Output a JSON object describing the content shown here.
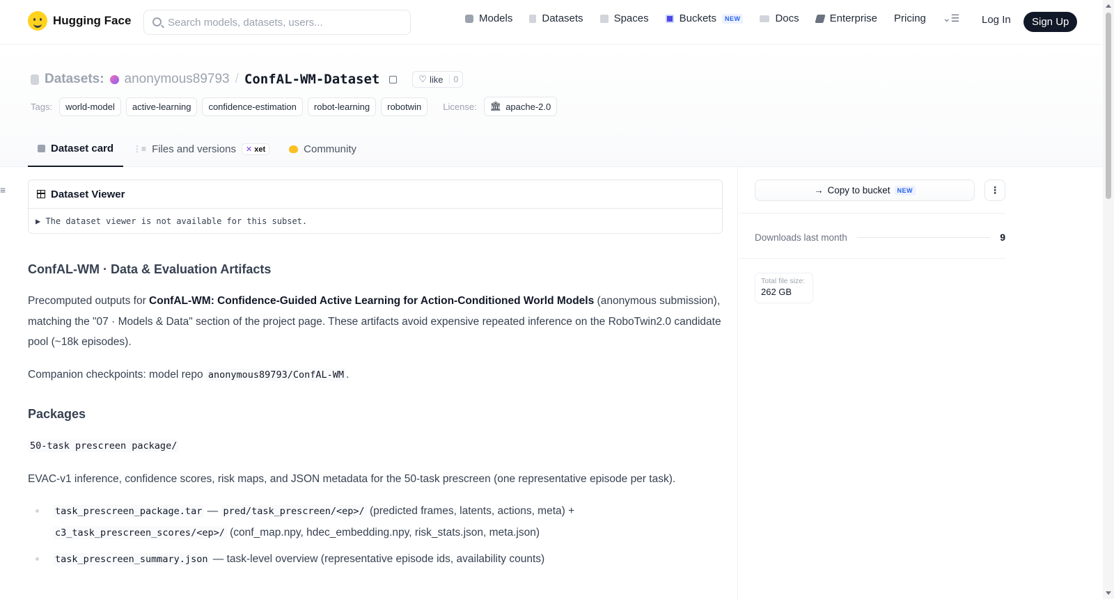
{
  "header": {
    "brand": "Hugging Face",
    "search_placeholder": "Search models, datasets, users...",
    "nav": [
      {
        "label": "Models",
        "icon": "model-cube-icon"
      },
      {
        "label": "Datasets",
        "icon": "database-icon"
      },
      {
        "label": "Spaces",
        "icon": "spaces-grid-icon"
      },
      {
        "label": "Buckets",
        "icon": "bucket-icon",
        "badge": "NEW"
      },
      {
        "label": "Docs",
        "icon": "book-icon"
      },
      {
        "label": "Enterprise",
        "icon": "enterprise-icon"
      },
      {
        "label": "Pricing"
      }
    ],
    "login": "Log In",
    "signup": "Sign Up"
  },
  "repo": {
    "type_label": "Datasets:",
    "owner": "anonymous89793",
    "separator": "/",
    "name": "ConfAL-WM-Dataset",
    "like_label": "like",
    "like_count": "0",
    "tags_label": "Tags:",
    "tags": [
      "world-model",
      "active-learning",
      "confidence-estimation",
      "robot-learning",
      "robotwin"
    ],
    "license_label": "License:",
    "license": "apache-2.0"
  },
  "tabs": [
    {
      "label": "Dataset card",
      "active": true
    },
    {
      "label": "Files and versions",
      "badge": "xet"
    },
    {
      "label": "Community"
    }
  ],
  "viewer": {
    "title": "Dataset Viewer",
    "message": "▶ The dataset viewer is not available for this subset."
  },
  "card": {
    "h1": "ConfAL-WM · Data & Evaluation Artifacts",
    "p1_pre": "Precomputed outputs for ",
    "p1_bold": "ConfAL-WM: Confidence-Guided Active Learning for Action-Conditioned World Models",
    "p1_post": " (anonymous submission), matching the \"07 · Models & Data\" section of the project page. These artifacts avoid expensive repeated inference on the RoboTwin2.0 candidate pool (~18k episodes).",
    "p2_pre": "Companion checkpoints: model repo ",
    "p2_code": "anonymous89793/ConfAL-WM",
    "p2_post": ".",
    "h2": "Packages",
    "pkg_code": "50-task prescreen package/",
    "p3": "EVAC-v1 inference, confidence scores, risk maps, and JSON metadata for the 50-task prescreen (one representative episode per task).",
    "li1_code1": "task_prescreen_package.tar",
    "li1_dash": " — ",
    "li1_code2": "pred/task_prescreen/<ep>/",
    "li1_text1": " (predicted frames, latents, actions, meta) + ",
    "li1_code3": "c3_task_prescreen_scores/<ep>/",
    "li1_text2": " (conf_map.npy, hdec_embedding.npy, risk_stats.json, meta.json)",
    "li2_code": "task_prescreen_summary.json",
    "li2_text": " — task-level overview (representative episode ids, availability counts)"
  },
  "sidebar": {
    "copy_button": "Copy to bucket",
    "copy_badge": "NEW",
    "downloads_label": "Downloads last month",
    "downloads_value": "9",
    "size_label": "Total file size:",
    "size_value": "262 GB"
  }
}
